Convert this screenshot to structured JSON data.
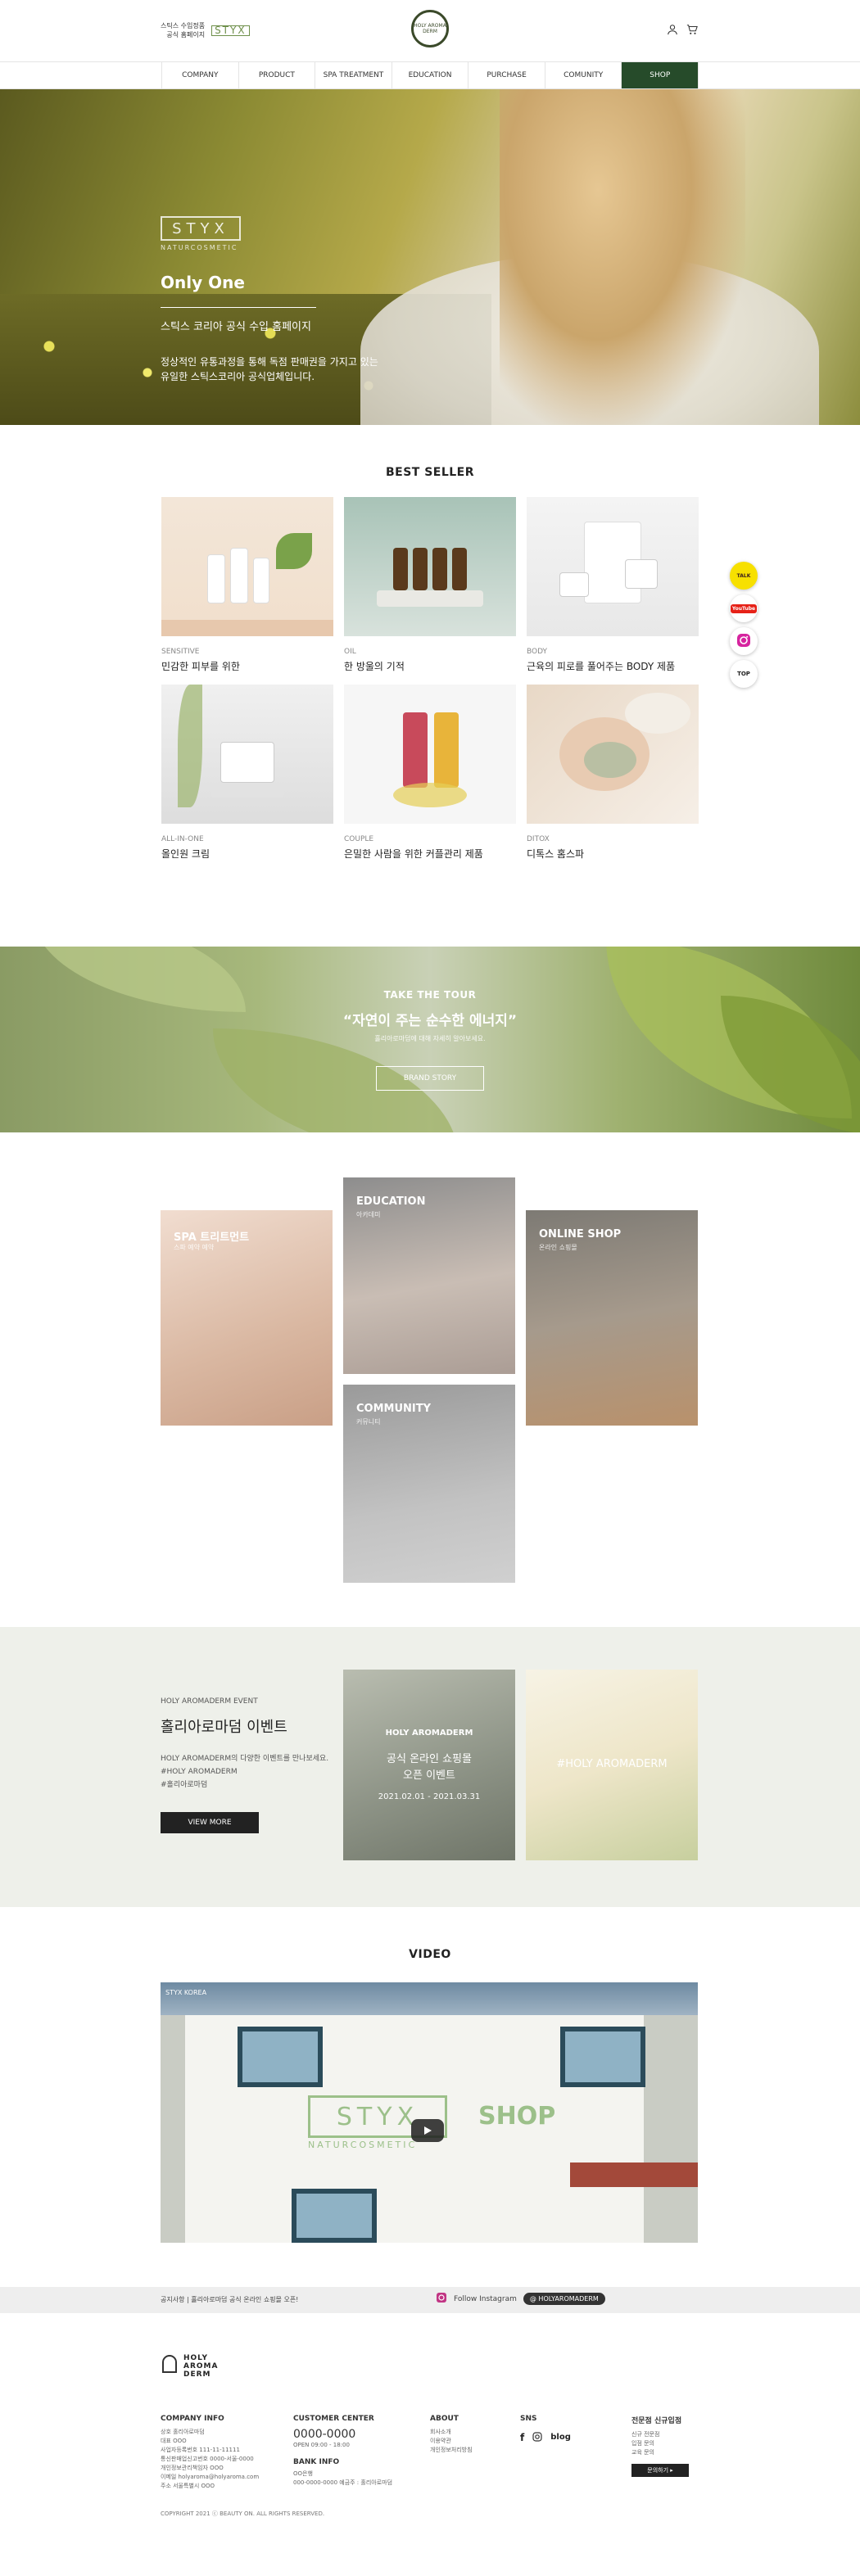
{
  "header": {
    "brand_line1": "스틱스 수입정품",
    "brand_line2": "공식 홈페이지",
    "brand_mark": "STYX",
    "logo_text": "HOLY AROMA DERM"
  },
  "nav": {
    "items": [
      "COMPANY",
      "PRODUCT",
      "SPA TREATMENT",
      "EDUCATION",
      "PURCHASE",
      "COMUNITY",
      "SHOP"
    ],
    "active": "SHOP"
  },
  "hero": {
    "logo": "STYX",
    "logo_sub": "NATURCOSMETIC",
    "only_one": "Only One",
    "title": "스틱스 코리아 공식 수입 홈페이지",
    "desc": "정상적인 유통과정을 통해 독점 판매권을 가지고 있는\n유일한 스틱스코리아 공식업체입니다."
  },
  "best_seller": {
    "title": "BEST SELLER",
    "items": [
      {
        "category": "SENSITIVE",
        "name": "민감한 피부를 위한"
      },
      {
        "category": "OIL",
        "name": "한 방울의 기적"
      },
      {
        "category": "BODY",
        "name": "근육의 피로를 풀어주는 BODY 제품"
      },
      {
        "category": "ALL-IN-ONE",
        "name": "올인원 크림"
      },
      {
        "category": "COUPLE",
        "name": "은밀한 사람을 위한 커플관리 제품"
      },
      {
        "category": "DITOX",
        "name": "디톡스 홈스파"
      }
    ]
  },
  "tour": {
    "kicker": "TAKE THE TOUR",
    "headline": "“자연이 주는 순수한 에너지”",
    "sub": "홀리아로마덤에 대해 자세히 알아보세요.",
    "button": "BRAND STORY"
  },
  "categories": [
    {
      "title": "SPA 트리트먼트",
      "sub": "스파 예약 예약"
    },
    {
      "title": "EDUCATION",
      "sub": "아카데미"
    },
    {
      "title": "ONLINE SHOP",
      "sub": "온라인 쇼핑몰"
    },
    {
      "title": "COMMUNITY",
      "sub": "커뮤니티"
    }
  ],
  "event": {
    "kicker": "HOLY AROMADERM EVENT",
    "title": "홀리아로마덤 이벤트",
    "desc": "HOLY AROMADERM의 다양한 이벤트를 만나보세요.\n#HOLY AROMADERM\n#홀리아로마덤",
    "button": "VIEW MORE",
    "banner1": {
      "brand": "HOLY AROMADERM",
      "line1": "공식 온라인 쇼핑몰",
      "line2": "오픈 이벤트",
      "dates": "2021.02.01 - 2021.03.31"
    },
    "banner2": {
      "brand": "#HOLY AROMADERM"
    }
  },
  "video": {
    "title": "VIDEO",
    "channel": "STYX KOREA",
    "sign": "STYX",
    "sign_sub": "NATURCOSMETIC",
    "shop": "SHOP"
  },
  "notice": {
    "label": "공지사항",
    "text": "홀리아로마덤 공식 온라인 쇼핑몰 오픈!",
    "follow": "Follow Instagram",
    "handle": "@ HOLYAROMADERM"
  },
  "footer": {
    "logo": [
      "HOLY",
      "AROMA",
      "DERM"
    ],
    "company": {
      "title": "COMPANY INFO",
      "lines": [
        "상호 홀리아로마덤",
        "대표 OOO",
        "사업자등록번호 111-11-11111",
        "통신판매업신고번호 0000-서울-0000",
        "개인정보관리책임자 OOO",
        "이메일 holyaroma@holyaroma.com",
        "주소 서울특별시 OOO"
      ]
    },
    "customer": {
      "title": "CUSTOMER CENTER",
      "phone": "0000-0000",
      "hours": "OPEN 09:00 - 18:00",
      "bank_title": "BANK INFO",
      "bank_lines": [
        "OO은행",
        "000-0000-0000 예금주 : 홀리아로마덤"
      ]
    },
    "about": {
      "title": "ABOUT",
      "lines": [
        "회사소개",
        "이용약관",
        "개인정보처리방침"
      ]
    },
    "sns": {
      "title": "SNS",
      "blog": "blog"
    },
    "partner": {
      "title": "전문점 신규입점",
      "lines": [
        "신규 전문점",
        "입점 문의",
        "교육 문의"
      ],
      "button": "문의하기 ▸"
    },
    "copyright": "COPYRIGHT 2021 ⓒ BEAUTY ON. ALL RIGHTS RESERVED."
  },
  "floating": {
    "kakao": "TALK",
    "youtube": "YouTube",
    "top": "TOP"
  }
}
